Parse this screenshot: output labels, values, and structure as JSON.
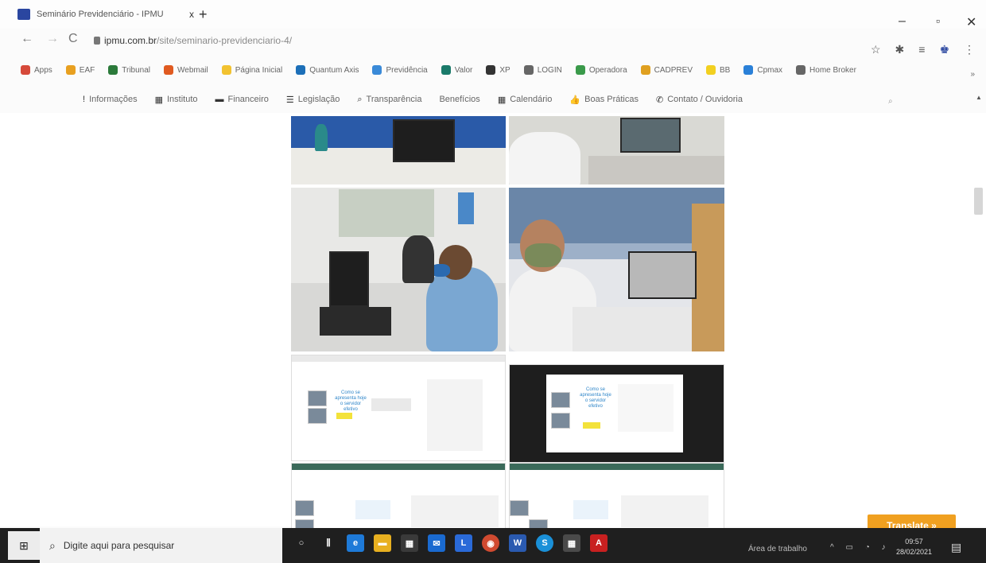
{
  "browser": {
    "tab_title": "Seminário Previdenciário - IPMU",
    "tab_close": "x",
    "new_tab": "+",
    "url_host": "ipmu.com.br",
    "url_path": "/site/seminario-previdenciario-4/",
    "window_min": "–",
    "window_max": "▫",
    "window_close": "✕",
    "back": "←",
    "forward": "→",
    "reload": "C"
  },
  "bookmarks": [
    {
      "label": "Apps",
      "color": "#d64a3a"
    },
    {
      "label": "EAF",
      "color": "#e8a020"
    },
    {
      "label": "Tribunal",
      "color": "#2b7a3a"
    },
    {
      "label": "Webmail",
      "color": "#e05a20"
    },
    {
      "label": "Página Inicial",
      "color": "#f2c230"
    },
    {
      "label": "Quantum Axis",
      "color": "#1c6fb8"
    },
    {
      "label": "Previdência",
      "color": "#3a8ad8"
    },
    {
      "label": "Valor",
      "color": "#1a7a6a"
    },
    {
      "label": "XP",
      "color": "#333333"
    },
    {
      "label": "LOGIN",
      "color": "#666666"
    },
    {
      "label": "Operadora",
      "color": "#3a9a4a"
    },
    {
      "label": "CADPREV",
      "color": "#e0a020"
    },
    {
      "label": "BB",
      "color": "#f2d020"
    },
    {
      "label": "Cpmax",
      "color": "#2a80d8"
    },
    {
      "label": "Home Broker",
      "color": "#666666"
    }
  ],
  "bookmarks_more": "»",
  "site_nav": [
    {
      "label": "Informações",
      "icon": "!"
    },
    {
      "label": "Instituto",
      "icon": "▦"
    },
    {
      "label": "Financeiro",
      "icon": "▬"
    },
    {
      "label": "Legislação",
      "icon": "☰"
    },
    {
      "label": "Transparência",
      "icon": "⌕"
    },
    {
      "label": "Benefícios",
      "icon": ""
    },
    {
      "label": "Calendário",
      "icon": "▦"
    },
    {
      "label": "Boas Práticas",
      "icon": "👍"
    },
    {
      "label": "Contato / Ouvidoria",
      "icon": "✆"
    }
  ],
  "gallery": {
    "slide_title": "Como se apresenta hoje o servidor efetivo",
    "slide_title_2": "Como se apresenta hoje o servidor efetivo"
  },
  "translate_label": "Translate »",
  "taskbar": {
    "search_placeholder": "Digite aqui para pesquisar",
    "tray_label": "Área de trabalho",
    "time": "09:57",
    "date": "28/02/2021"
  }
}
